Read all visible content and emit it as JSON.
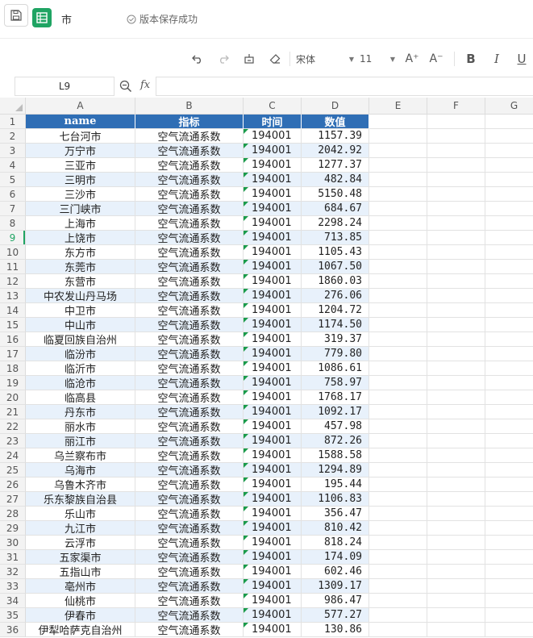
{
  "app": {
    "doc_title": "市",
    "save_status": "版本保存成功"
  },
  "toolbar": {
    "font_name": "宋体",
    "font_size": "11",
    "bold_label": "B",
    "italic_label": "I",
    "underline_label": "U",
    "increase_font_label": "A⁺",
    "decrease_font_label": "A⁻"
  },
  "formula_bar": {
    "cell_ref": "L9",
    "fx_label": "fx",
    "value": ""
  },
  "colors": {
    "header_bg": "#2f6eb5",
    "stripe_bg": "#e8f1fb",
    "accent": "#1fa463"
  },
  "grid": {
    "columns": [
      "A",
      "B",
      "C",
      "D",
      "E",
      "F",
      "G"
    ],
    "active_row": 9,
    "header_row": [
      "name",
      "指标",
      "时间",
      "数值"
    ],
    "rows": [
      [
        "七台河市",
        "空气流通系数",
        "194001",
        "1157.39"
      ],
      [
        "万宁市",
        "空气流通系数",
        "194001",
        "2042.92"
      ],
      [
        "三亚市",
        "空气流通系数",
        "194001",
        "1277.37"
      ],
      [
        "三明市",
        "空气流通系数",
        "194001",
        "482.84"
      ],
      [
        "三沙市",
        "空气流通系数",
        "194001",
        "5150.48"
      ],
      [
        "三门峡市",
        "空气流通系数",
        "194001",
        "684.67"
      ],
      [
        "上海市",
        "空气流通系数",
        "194001",
        "2298.24"
      ],
      [
        "上饶市",
        "空气流通系数",
        "194001",
        "713.85"
      ],
      [
        "东方市",
        "空气流通系数",
        "194001",
        "1105.43"
      ],
      [
        "东莞市",
        "空气流通系数",
        "194001",
        "1067.50"
      ],
      [
        "东营市",
        "空气流通系数",
        "194001",
        "1860.03"
      ],
      [
        "中农发山丹马场",
        "空气流通系数",
        "194001",
        "276.06"
      ],
      [
        "中卫市",
        "空气流通系数",
        "194001",
        "1204.72"
      ],
      [
        "中山市",
        "空气流通系数",
        "194001",
        "1174.50"
      ],
      [
        "临夏回族自治州",
        "空气流通系数",
        "194001",
        "319.37"
      ],
      [
        "临汾市",
        "空气流通系数",
        "194001",
        "779.80"
      ],
      [
        "临沂市",
        "空气流通系数",
        "194001",
        "1086.61"
      ],
      [
        "临沧市",
        "空气流通系数",
        "194001",
        "758.97"
      ],
      [
        "临高县",
        "空气流通系数",
        "194001",
        "1768.17"
      ],
      [
        "丹东市",
        "空气流通系数",
        "194001",
        "1092.17"
      ],
      [
        "丽水市",
        "空气流通系数",
        "194001",
        "457.98"
      ],
      [
        "丽江市",
        "空气流通系数",
        "194001",
        "872.26"
      ],
      [
        "乌兰察布市",
        "空气流通系数",
        "194001",
        "1588.58"
      ],
      [
        "乌海市",
        "空气流通系数",
        "194001",
        "1294.89"
      ],
      [
        "乌鲁木齐市",
        "空气流通系数",
        "194001",
        "195.44"
      ],
      [
        "乐东黎族自治县",
        "空气流通系数",
        "194001",
        "1106.83"
      ],
      [
        "乐山市",
        "空气流通系数",
        "194001",
        "356.47"
      ],
      [
        "九江市",
        "空气流通系数",
        "194001",
        "810.42"
      ],
      [
        "云浮市",
        "空气流通系数",
        "194001",
        "818.24"
      ],
      [
        "五家渠市",
        "空气流通系数",
        "194001",
        "174.09"
      ],
      [
        "五指山市",
        "空气流通系数",
        "194001",
        "602.46"
      ],
      [
        "亳州市",
        "空气流通系数",
        "194001",
        "1309.17"
      ],
      [
        "仙桃市",
        "空气流通系数",
        "194001",
        "986.47"
      ],
      [
        "伊春市",
        "空气流通系数",
        "194001",
        "577.27"
      ],
      [
        "伊犁哈萨克自治州",
        "空气流通系数",
        "194001",
        "130.86"
      ]
    ]
  }
}
